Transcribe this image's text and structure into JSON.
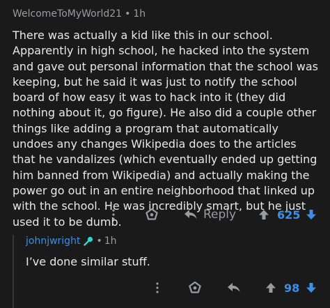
{
  "comment": {
    "author": "WelcomeToMyWorld21",
    "separator": "•",
    "time": "1h",
    "body": "There was actually a kid like this in our school. Apparently in high school, he hacked into the system and gave out personal information that the school was keeping, but he said it was just to notify the school board of how easy it was to hack into it (they did nothing about it, go figure). He also did a couple other things like adding a program that automatically undoes any changes Wikipedia does to the articles that he vandalizes (which eventually ended up getting him banned from Wikipedia) and actually making the power go out in an entire neighborhood that linked up with the school. He was incredibly smart, but he just used it to be dumb.",
    "actions": {
      "reply_label": "Reply",
      "score": "625"
    }
  },
  "reply": {
    "author": "johnjwright",
    "separator": "•",
    "time": "1h",
    "body": "I’ve done similar stuff.",
    "actions": {
      "score": "98"
    }
  },
  "icons": {
    "more": "more-vertical-icon",
    "award": "award-icon",
    "reply": "reply-arrow-icon",
    "upvote": "upvote-arrow-icon",
    "downvote": "downvote-arrow-icon",
    "flair": "microphone-flair-icon"
  },
  "colors": {
    "background": "#1a1a1b",
    "text": "#e8e8e8",
    "muted": "#9a9c9f",
    "accent": "#3d8fe5",
    "flair": "#33d6c7"
  }
}
